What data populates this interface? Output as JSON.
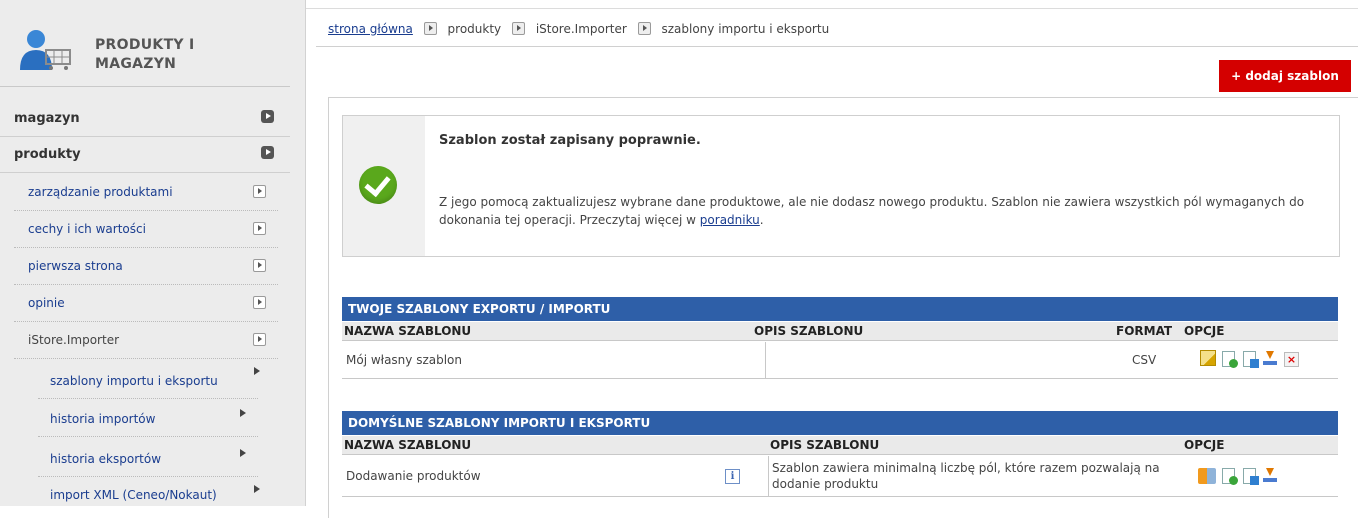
{
  "sidebar": {
    "title_line1": "PRODUKTY I",
    "title_line2": "MAGAZYN",
    "sections": [
      {
        "label": "magazyn"
      },
      {
        "label": "produkty"
      }
    ],
    "items": [
      {
        "label": "zarządzanie produktami"
      },
      {
        "label": "cechy i ich wartości"
      },
      {
        "label": "pierwsza strona"
      },
      {
        "label": "opinie"
      },
      {
        "label": "iStore.Importer"
      }
    ],
    "subitems": [
      {
        "label": "szablony importu i eksportu"
      },
      {
        "label": "historia importów"
      },
      {
        "label": "historia eksportów"
      },
      {
        "label": "import XML (Ceneo/Nokaut)"
      }
    ]
  },
  "breadcrumb": {
    "home": "strona główna",
    "b1": "produkty",
    "b2": "iStore.Importer",
    "b3": "szablony importu i eksportu"
  },
  "add_button": "+ dodaj szablon",
  "message": {
    "title": "Szablon został zapisany poprawnie.",
    "text_before": "Z jego pomocą zaktualizujesz wybrane dane produktowe, ale nie dodasz nowego produktu. Szablon nie zawiera wszystkich pól wymaganych do dokonania tej operacji. Przeczytaj więcej w ",
    "link": "poradniku",
    "text_after": "."
  },
  "table1": {
    "header": "TWOJE SZABLONY EXPORTU / IMPORTU",
    "col_name": "NAZWA SZABLONU",
    "col_desc": "OPIS SZABLONU",
    "col_format": "FORMAT",
    "col_options": "OPCJE",
    "rows": [
      {
        "name": "Mój własny szablon",
        "desc": "",
        "format": "CSV"
      }
    ]
  },
  "table2": {
    "header": "DOMYŚLNE SZABLONY IMPORTU I EKSPORTU",
    "col_name": "NAZWA SZABLONU",
    "col_desc": "OPIS SZABLONU",
    "col_options": "OPCJE",
    "rows": [
      {
        "name": "Dodawanie produktów",
        "desc": "Szablon zawiera minimalną liczbę pól, które razem pozwalają na dodanie produktu"
      }
    ]
  },
  "colors": {
    "accent_red": "#d40000",
    "table_header_blue": "#2e5fa8",
    "success_green": "#5aa81c",
    "link_blue": "#1a3d8f"
  }
}
